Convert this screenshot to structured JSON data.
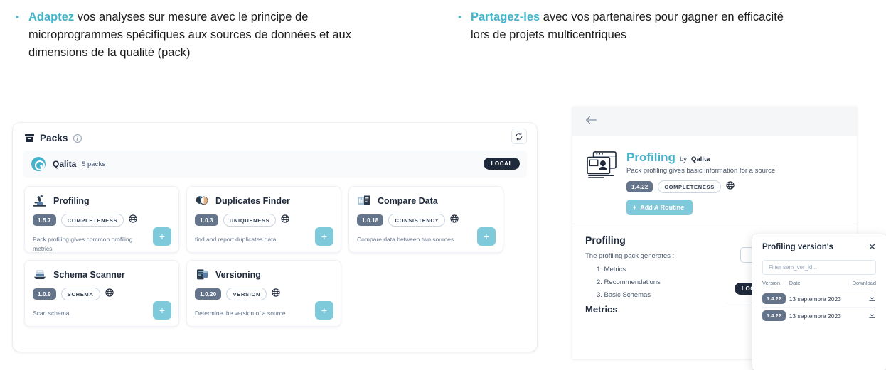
{
  "bullets": [
    {
      "marker": "•",
      "highlight": "Adaptez",
      "text": " vos analyses sur mesure avec le principe de microprogrammes spécifiques aux sources de données et aux dimensions de la qualité (pack)"
    },
    {
      "marker": "•",
      "highlight": "Partagez-les",
      "text": " avec vos partenaires pour gagner en efficacité lors de projets multicentriques"
    }
  ],
  "packs_panel": {
    "title": "Packs",
    "info_icon": "info-icon",
    "refresh_icon": "refresh-icon",
    "vendor": {
      "logo": "qalita-logo",
      "name": "Qalita",
      "count": "5 packs",
      "badge": "LOCAL"
    },
    "cards": [
      {
        "icon": "microscope-icon",
        "name": "Profiling",
        "version": "1.5.7",
        "dimension": "COMPLETENESS",
        "globe_icon": "globe-icon",
        "description": "Pack profiling gives common profiling metrics",
        "add_label": "+"
      },
      {
        "icon": "duplicates-pie-icon",
        "name": "Duplicates Finder",
        "version": "1.0.3",
        "dimension": "UNIQUENESS",
        "globe_icon": "globe-icon",
        "description": "find and report duplicates data",
        "add_label": "+"
      },
      {
        "icon": "compare-chart-icon",
        "name": "Compare Data",
        "version": "1.0.18",
        "dimension": "CONSISTENCY",
        "globe_icon": "globe-icon",
        "description": "Compare data between two sources",
        "add_label": "+"
      },
      {
        "icon": "scanner-icon",
        "name": "Schema Scanner",
        "version": "1.0.9",
        "dimension": "SCHEMA",
        "globe_icon": "globe-icon",
        "description": "Scan schema",
        "add_label": "+"
      },
      {
        "icon": "database-icon",
        "name": "Versioning",
        "version": "1.0.20",
        "dimension": "VERSION",
        "globe_icon": "globe-icon",
        "description": "Determine the version of a source",
        "add_label": "+"
      }
    ]
  },
  "pack_detail": {
    "back_icon": "back-arrow-icon",
    "icon": "pack-window-person-icon",
    "title": "Profiling",
    "by_label": "by",
    "vendor": "Qalita",
    "subtitle": "Pack profiling gives basic information for a source",
    "version": "1.4.22",
    "dimension": "COMPLETENESS",
    "globe_icon": "globe-icon",
    "routine_button": "Add A Routine",
    "routine_plus": "+",
    "body": {
      "heading": "Profiling",
      "intro": "The profiling pack generates :",
      "list": [
        "1. Metrics",
        "2. Recommendations",
        "3. Basic Schemas"
      ],
      "subheading": "Metrics",
      "local_badge": "LOCAL"
    }
  },
  "versions_dialog": {
    "title": "Profiling version's",
    "close_icon": "close-icon",
    "filter_placeholder": "Filter sem_ver_id...",
    "columns": [
      "Version",
      "Date",
      "Download"
    ],
    "rows": [
      {
        "version": "1.4.22",
        "date": "13 septembre 2023",
        "download_icon": "download-icon"
      },
      {
        "version": "1.4.22",
        "date": "13 septembre 2023",
        "download_icon": "download-icon"
      }
    ]
  },
  "colors": {
    "accent_teal": "#45b3c9",
    "button_teal": "#7ec9da",
    "slate_badge": "#64748b",
    "dark_badge": "#1e293b"
  }
}
